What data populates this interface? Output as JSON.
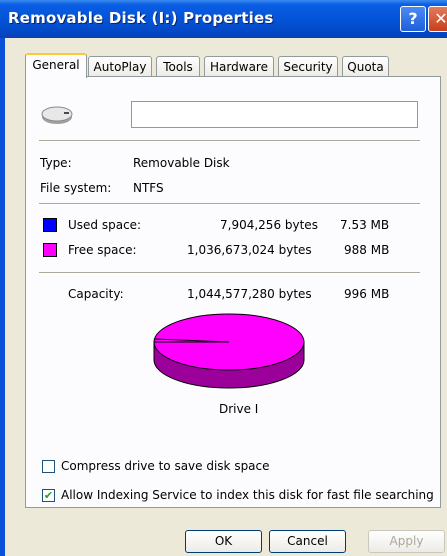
{
  "window": {
    "title": "Removable Disk (I:) Properties",
    "help_glyph": "?",
    "close_glyph": "✕"
  },
  "tabs": [
    {
      "label": "General",
      "active": true
    },
    {
      "label": "AutoPlay"
    },
    {
      "label": "Tools"
    },
    {
      "label": "Hardware"
    },
    {
      "label": "Security"
    },
    {
      "label": "Quota"
    }
  ],
  "general": {
    "name_value": "",
    "type_label": "Type:",
    "type_value": "Removable Disk",
    "fs_label": "File system:",
    "fs_value": "NTFS",
    "used": {
      "label": "Used space:",
      "bytes": "7,904,256 bytes",
      "size": "7.53 MB",
      "color": "#0000ff"
    },
    "free": {
      "label": "Free space:",
      "bytes": "1,036,673,024 bytes",
      "size": "988 MB",
      "color": "#ff00ff"
    },
    "capacity": {
      "label": "Capacity:",
      "bytes": "1,044,577,280 bytes",
      "size": "996 MB"
    },
    "drive_label": "Drive I",
    "compress": {
      "label": "Compress drive to save disk space",
      "checked": false
    },
    "indexing": {
      "label": "Allow Indexing Service to index this disk for fast file searching",
      "checked": true
    }
  },
  "buttons": {
    "ok": "OK",
    "cancel": "Cancel",
    "apply": "Apply"
  },
  "icons": {
    "drive": "removable-drive-icon"
  }
}
